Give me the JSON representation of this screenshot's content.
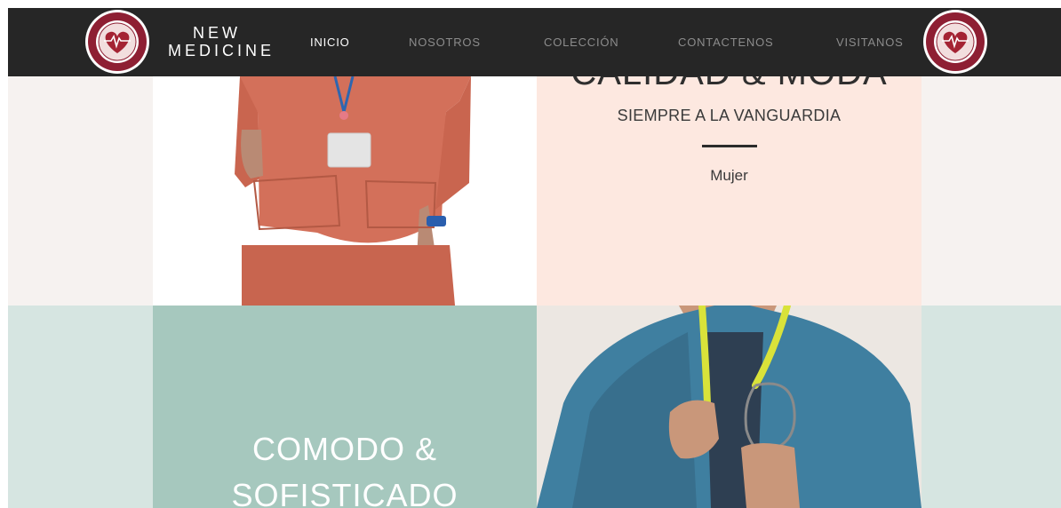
{
  "brand": {
    "line1": "NEW",
    "line2": "MEDICINE"
  },
  "logo": {
    "ring_text": "NEW MEDICINE"
  },
  "nav": {
    "items": [
      {
        "label": "INICIO",
        "active": true
      },
      {
        "label": "NOSOTROS",
        "active": false
      },
      {
        "label": "COLECCIÓN",
        "active": false
      },
      {
        "label": "CONTACTENOS",
        "active": false
      },
      {
        "label": "VISITANOS",
        "active": false
      }
    ]
  },
  "panel1": {
    "heading": "CALIDAD & MODA",
    "subheading": "SIEMPRE A LA VANGUARDIA",
    "link": "Mujer"
  },
  "panel2": {
    "heading_line1": "COMODO &",
    "heading_line2": "SOFISTICADO"
  },
  "colors": {
    "navbar": "#262626",
    "pink_panel": "#fde8e0",
    "teal_panel": "#a6c8be",
    "scrub_orange": "#d3705a",
    "scrub_blue": "#3f7fa0"
  }
}
